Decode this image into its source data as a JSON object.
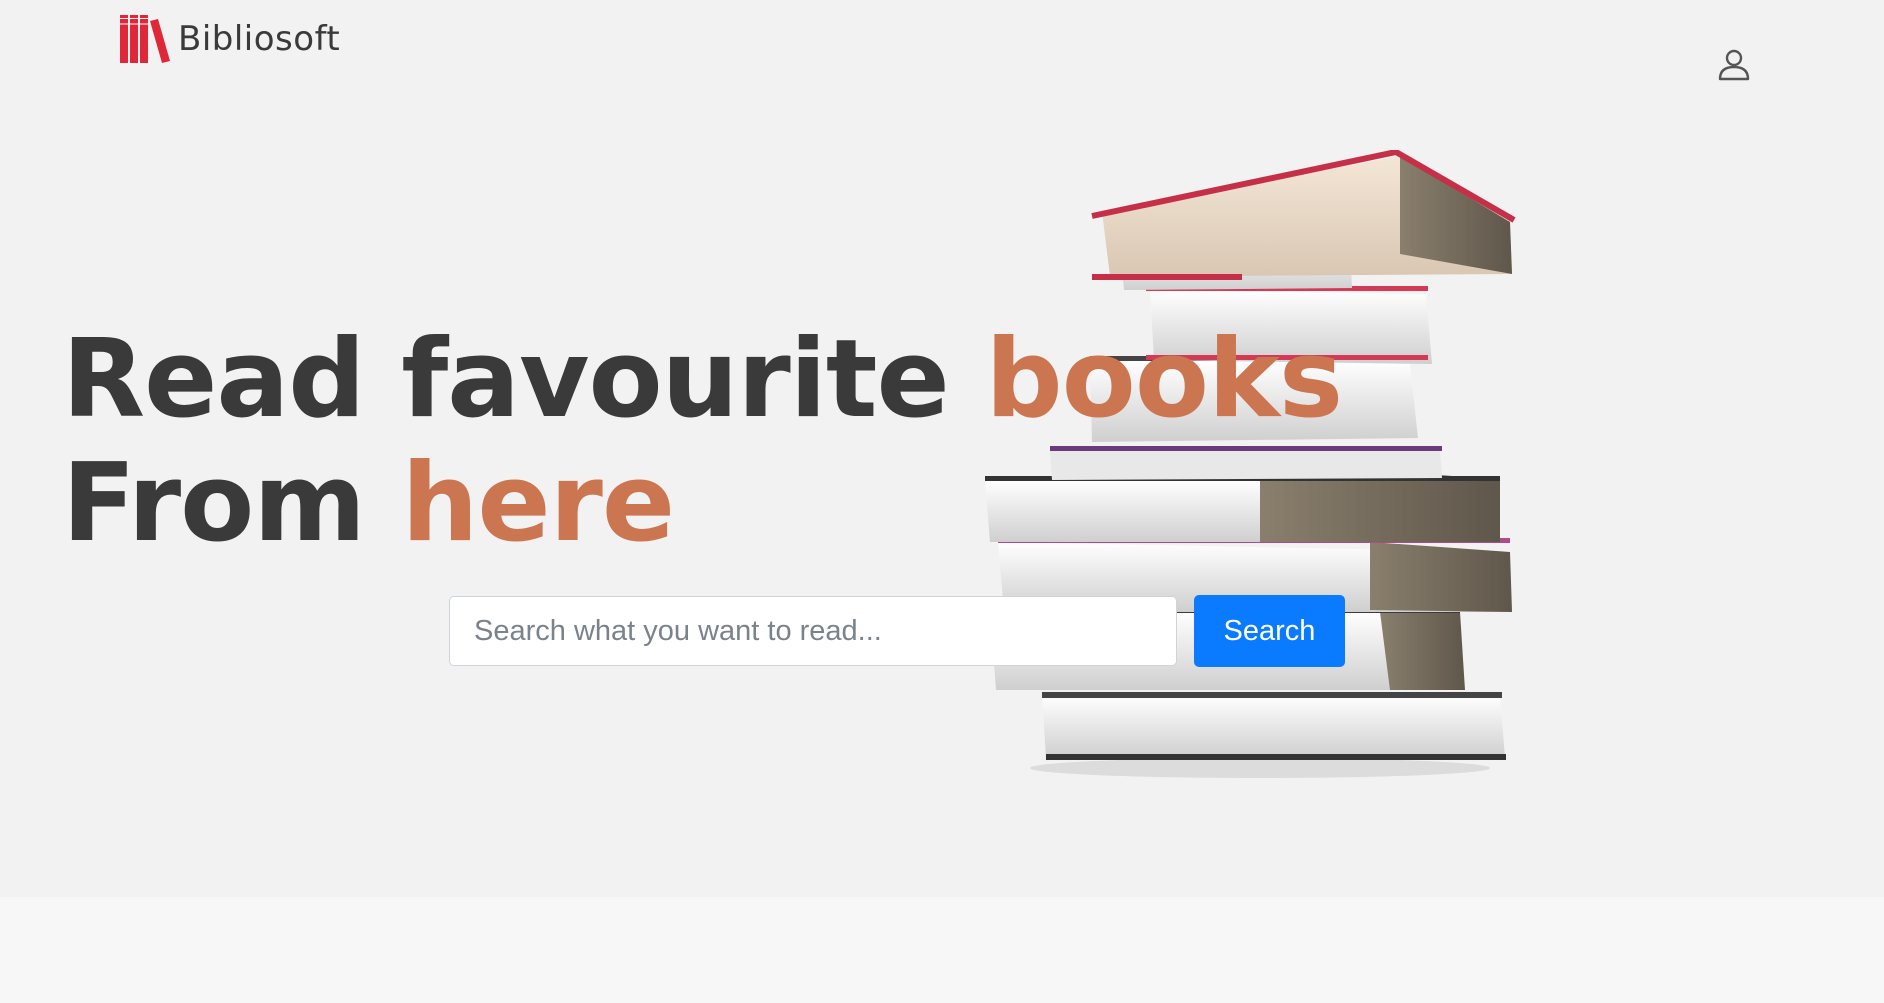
{
  "header": {
    "brand_name": "Bibliosoft",
    "logo_icon": "books-logo-icon",
    "user_icon": "user-account-icon"
  },
  "hero": {
    "headline_line1_text": "Read favourite ",
    "headline_line1_accent": "books",
    "headline_line2_text": "From ",
    "headline_line2_accent": "here",
    "illustration": "stack-of-books-image"
  },
  "search": {
    "placeholder": "Search what you want to read...",
    "value": "",
    "button_label": "Search"
  },
  "colors": {
    "accent": "#cc7651",
    "heading": "#3a3a3a",
    "primary_button": "#0a7bff",
    "logo_red": "#e0273a",
    "hero_background": "#f2f2f2"
  }
}
